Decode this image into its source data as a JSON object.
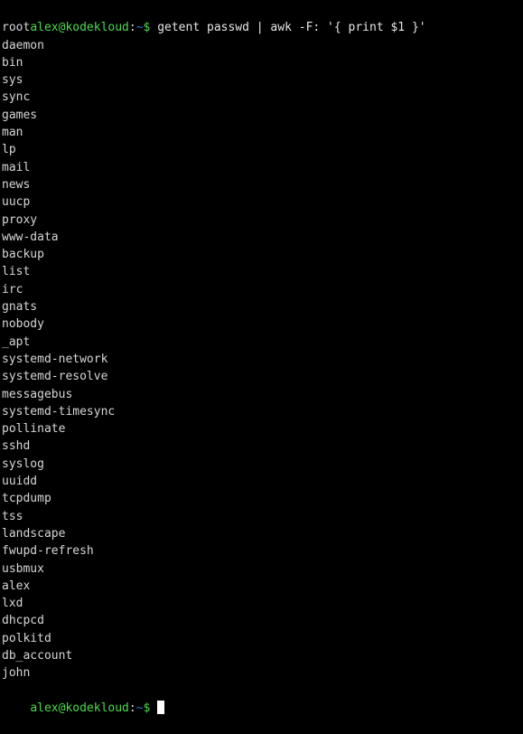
{
  "terminal": {
    "window_title": "",
    "background_color": "#000000",
    "foreground_color": "#d6d6d6",
    "prompt": {
      "user_host": "alex@kodekloud",
      "colon": ":",
      "path": "~",
      "sigil": "$",
      "user_host_color": "#4cdb4c",
      "path_color": "#2f6fd0",
      "sigil_color": "#4cdb4c"
    },
    "command": "getent passwd | awk -F: '{ print $1 }'",
    "output_lines": [
      "root",
      "daemon",
      "bin",
      "sys",
      "sync",
      "games",
      "man",
      "lp",
      "mail",
      "news",
      "uucp",
      "proxy",
      "www-data",
      "backup",
      "list",
      "irc",
      "gnats",
      "nobody",
      "_apt",
      "systemd-network",
      "systemd-resolve",
      "messagebus",
      "systemd-timesync",
      "pollinate",
      "sshd",
      "syslog",
      "uuidd",
      "tcpdump",
      "tss",
      "landscape",
      "fwupd-refresh",
      "usbmux",
      "alex",
      "lxd",
      "dhcpcd",
      "polkitd",
      "db_account",
      "john"
    ],
    "final_prompt_input": "",
    "cursor": "block-cursor"
  }
}
